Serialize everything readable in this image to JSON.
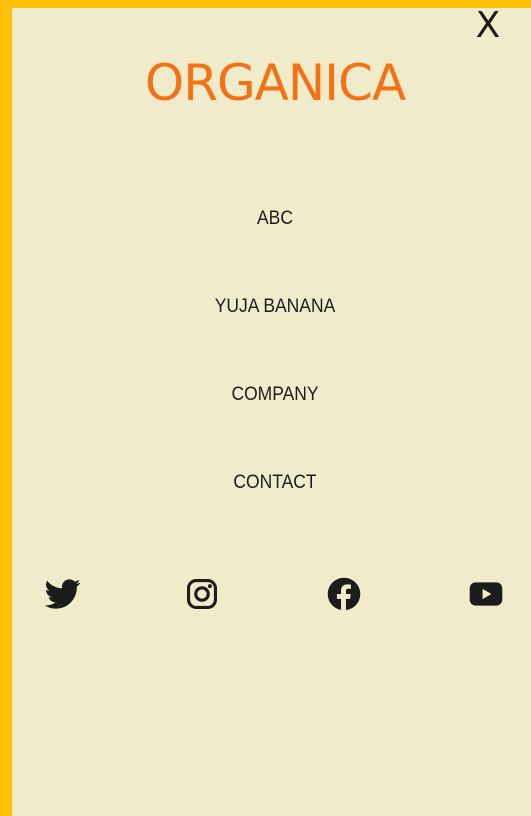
{
  "menu": {
    "close_label": "X",
    "brand": "ORGANICA",
    "brand_color": "#f47216",
    "background_color": "#f0eccb",
    "frame_color": "#ffc107",
    "items": [
      {
        "label": "ABC"
      },
      {
        "label": "YUJA BANANA"
      },
      {
        "label": "COMPANY"
      },
      {
        "label": "CONTACT"
      }
    ],
    "social_icons": [
      "twitter-icon",
      "instagram-icon",
      "facebook-icon",
      "youtube-icon"
    ]
  }
}
